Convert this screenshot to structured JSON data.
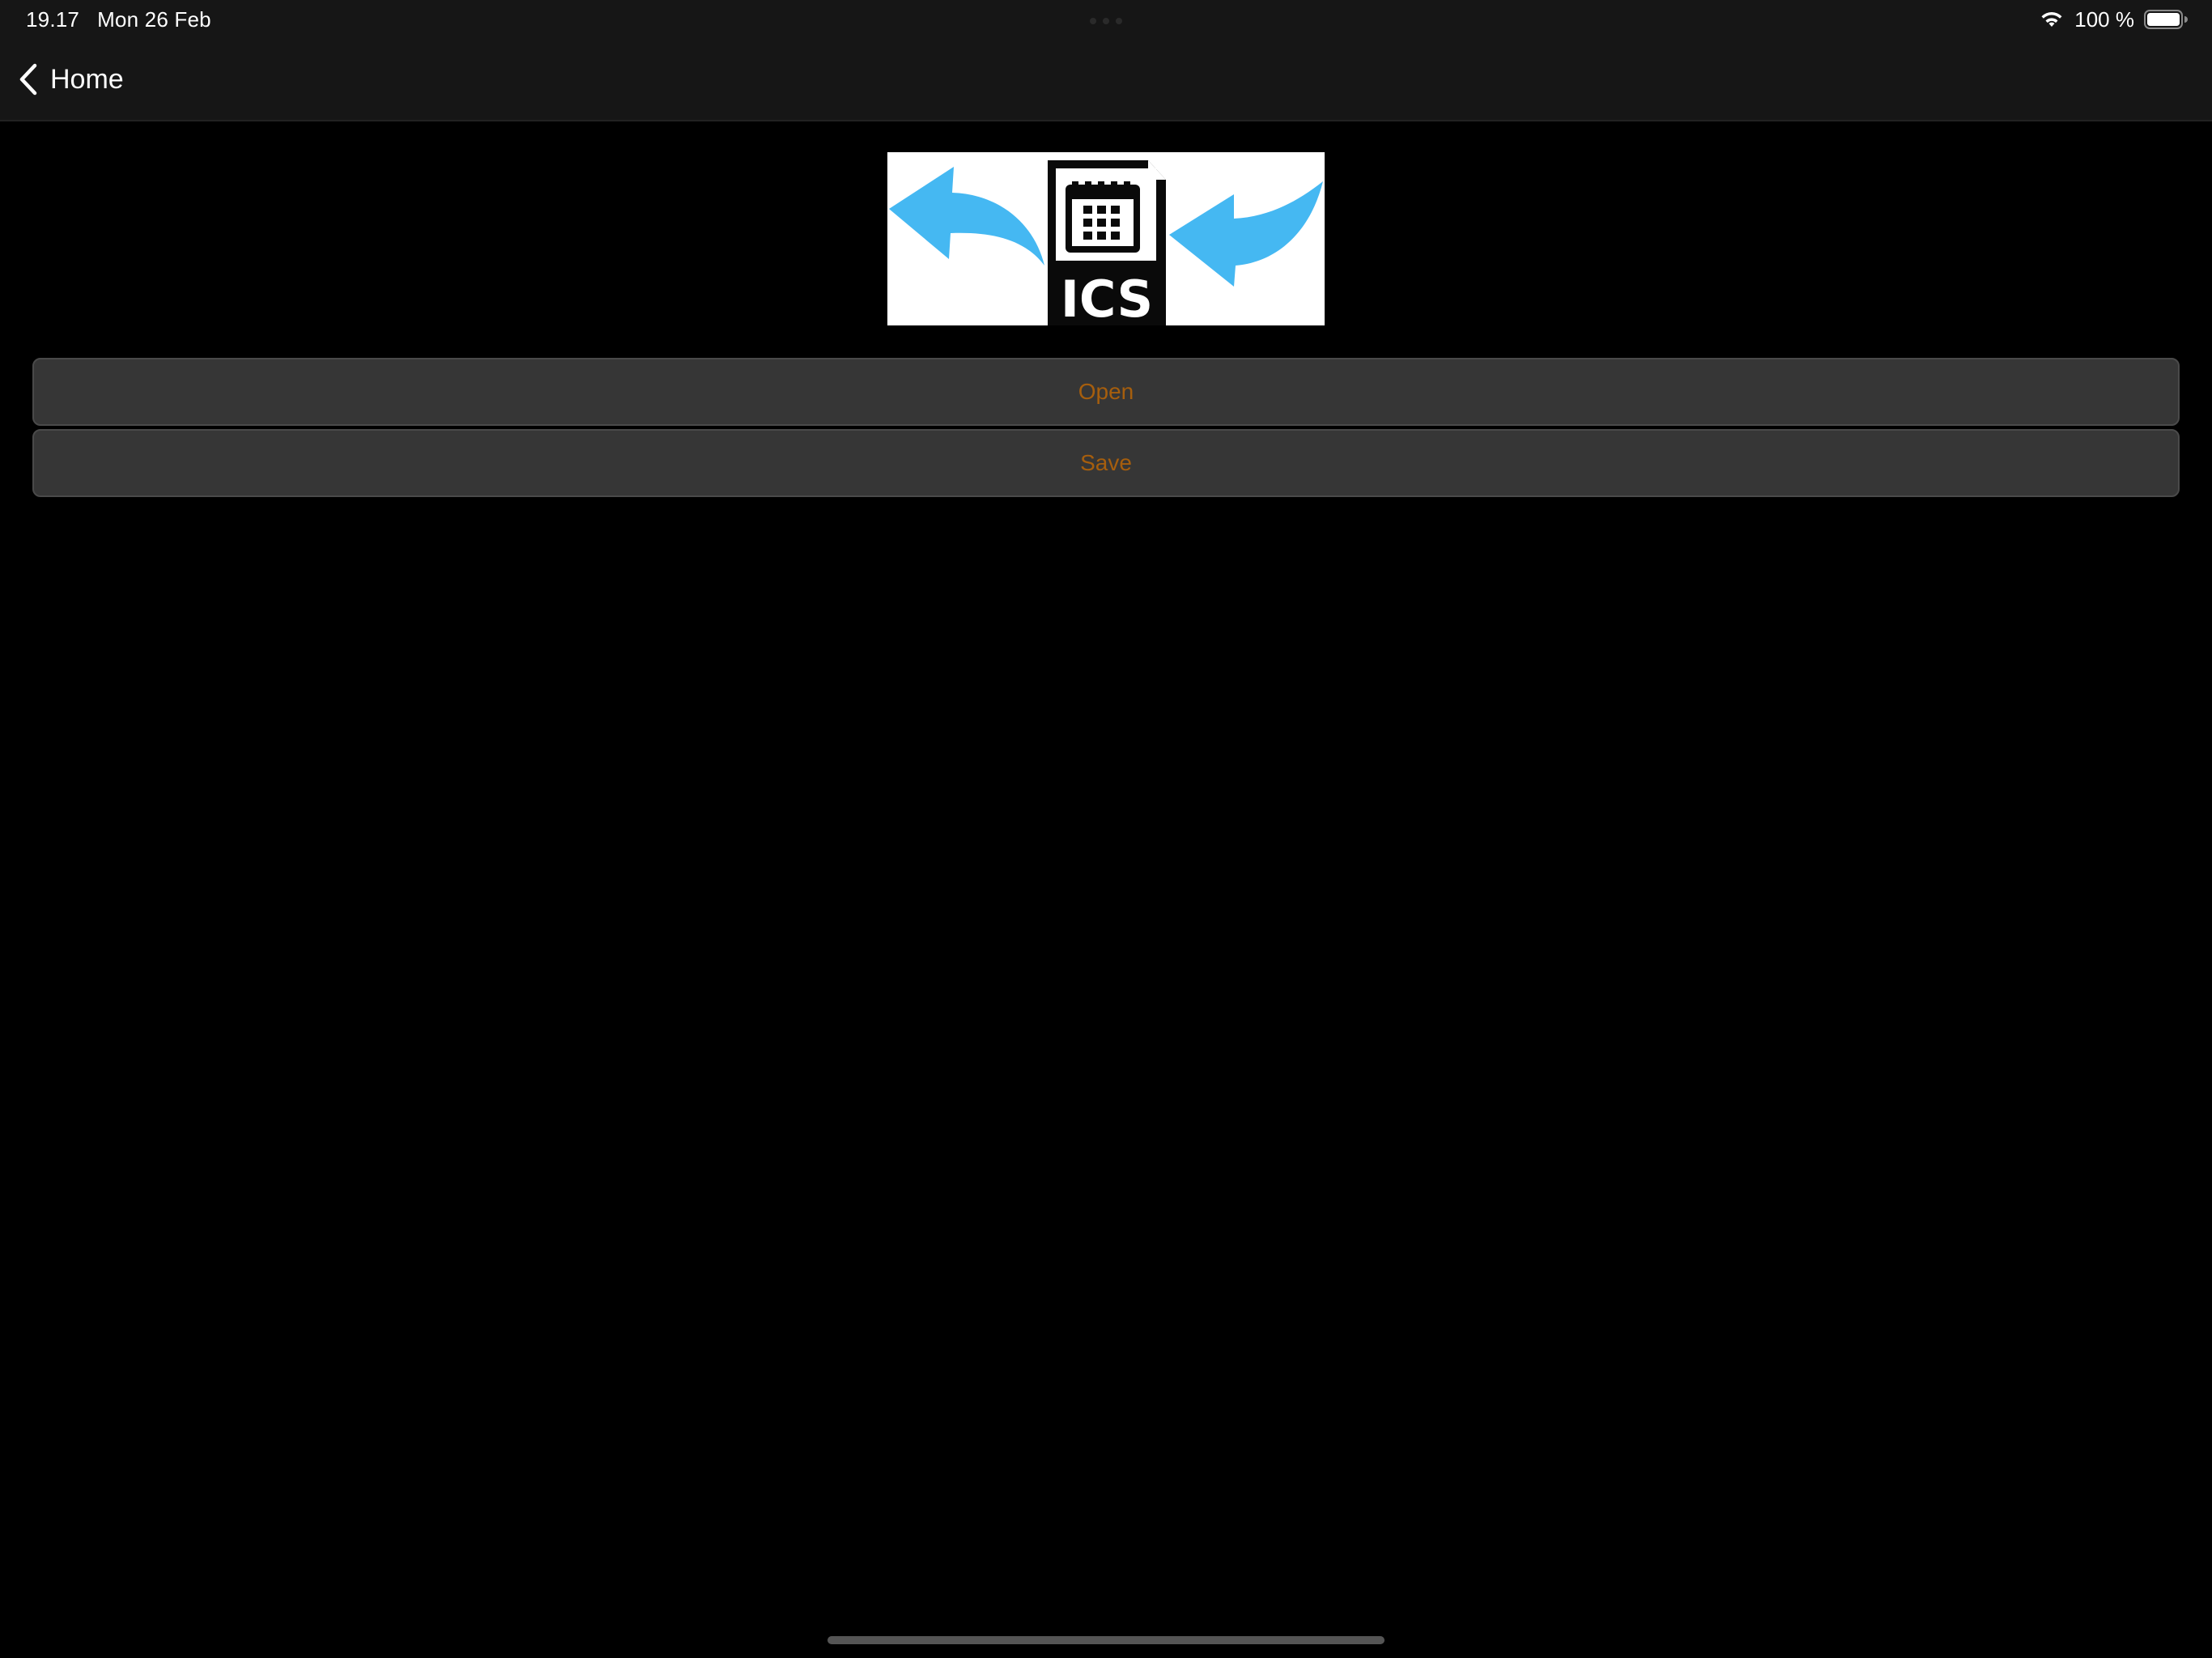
{
  "status_bar": {
    "time": "19.17",
    "date": "Mon 26 Feb",
    "battery_percent": "100 %",
    "battery_level": 1.0,
    "icons": [
      "wifi-icon",
      "battery-icon"
    ]
  },
  "nav": {
    "back_label": "Home",
    "back_icon": "chevron-left-icon"
  },
  "logo": {
    "text": "ICS",
    "icons": [
      "arrow-left-icon",
      "calendar-file-icon",
      "arrow-left-icon"
    ],
    "arrow_color": "#45b8f2"
  },
  "buttons": {
    "open_label": "Open",
    "save_label": "Save"
  },
  "colors": {
    "background": "#000000",
    "bar_background": "#161616",
    "button_background": "#363636",
    "button_text": "#a65e0d"
  }
}
